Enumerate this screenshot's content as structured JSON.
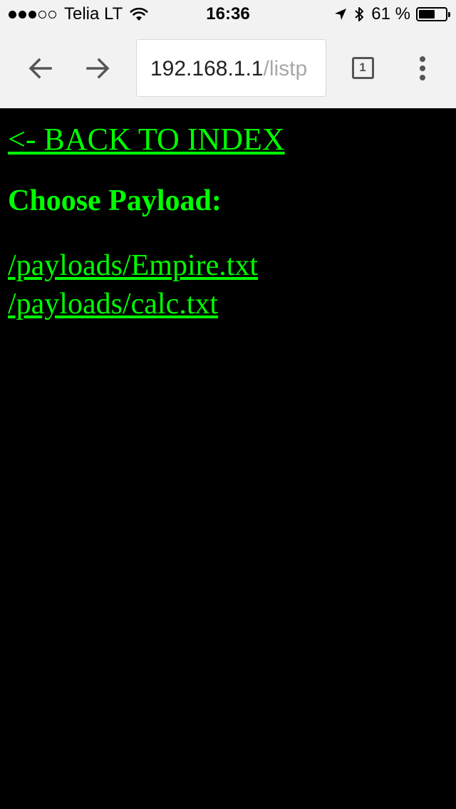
{
  "status_bar": {
    "carrier": "Telia LT",
    "signal_bars_filled": 3,
    "signal_bars_total": 5,
    "time": "16:36",
    "battery_percent": "61 %",
    "battery_level": 0.61
  },
  "browser": {
    "url_host": "192.168.1.1",
    "url_path": "/listp",
    "tab_count": "1"
  },
  "page": {
    "back_link": "<- BACK TO INDEX",
    "heading": "Choose Payload:",
    "payloads": [
      "/payloads/Empire.txt",
      "/payloads/calc.txt"
    ]
  },
  "colors": {
    "page_background": "#000000",
    "link_color": "#00ff00",
    "toolbar_background": "#f2f2f2"
  }
}
